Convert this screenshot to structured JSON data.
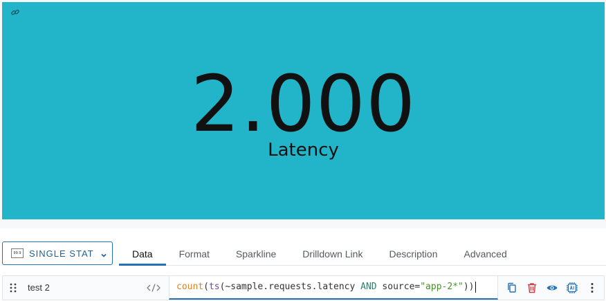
{
  "stat": {
    "value": "2.000",
    "label": "Latency"
  },
  "colors": {
    "panel_background": "#22b5c9",
    "accent": "#1f72b8",
    "delete": "#d0373a"
  },
  "icons": {
    "link": "link-icon",
    "chevron": "chevron-down-icon",
    "drag": "drag-handle-icon",
    "code": "code-icon",
    "copy": "copy-icon",
    "delete": "trash-icon",
    "visibility": "eye-icon",
    "ai": "ai-chip-icon",
    "more": "more-vertical-icon"
  },
  "visualization": {
    "thumb_label": "99.9",
    "selected": "SINGLE STAT"
  },
  "tabs": [
    {
      "label": "Data",
      "active": true
    },
    {
      "label": "Format",
      "active": false
    },
    {
      "label": "Sparkline",
      "active": false
    },
    {
      "label": "Drilldown Link",
      "active": false
    },
    {
      "label": "Description",
      "active": false
    },
    {
      "label": "Advanced",
      "active": false
    }
  ],
  "query": {
    "name": "test 2",
    "tokens": {
      "func": "count",
      "open1": "(",
      "ts": "ts",
      "open2": "(",
      "metric": "~sample.requests.latency ",
      "op": "AND",
      "key": " source=",
      "str": "\"app-2*\"",
      "close": "))"
    }
  }
}
